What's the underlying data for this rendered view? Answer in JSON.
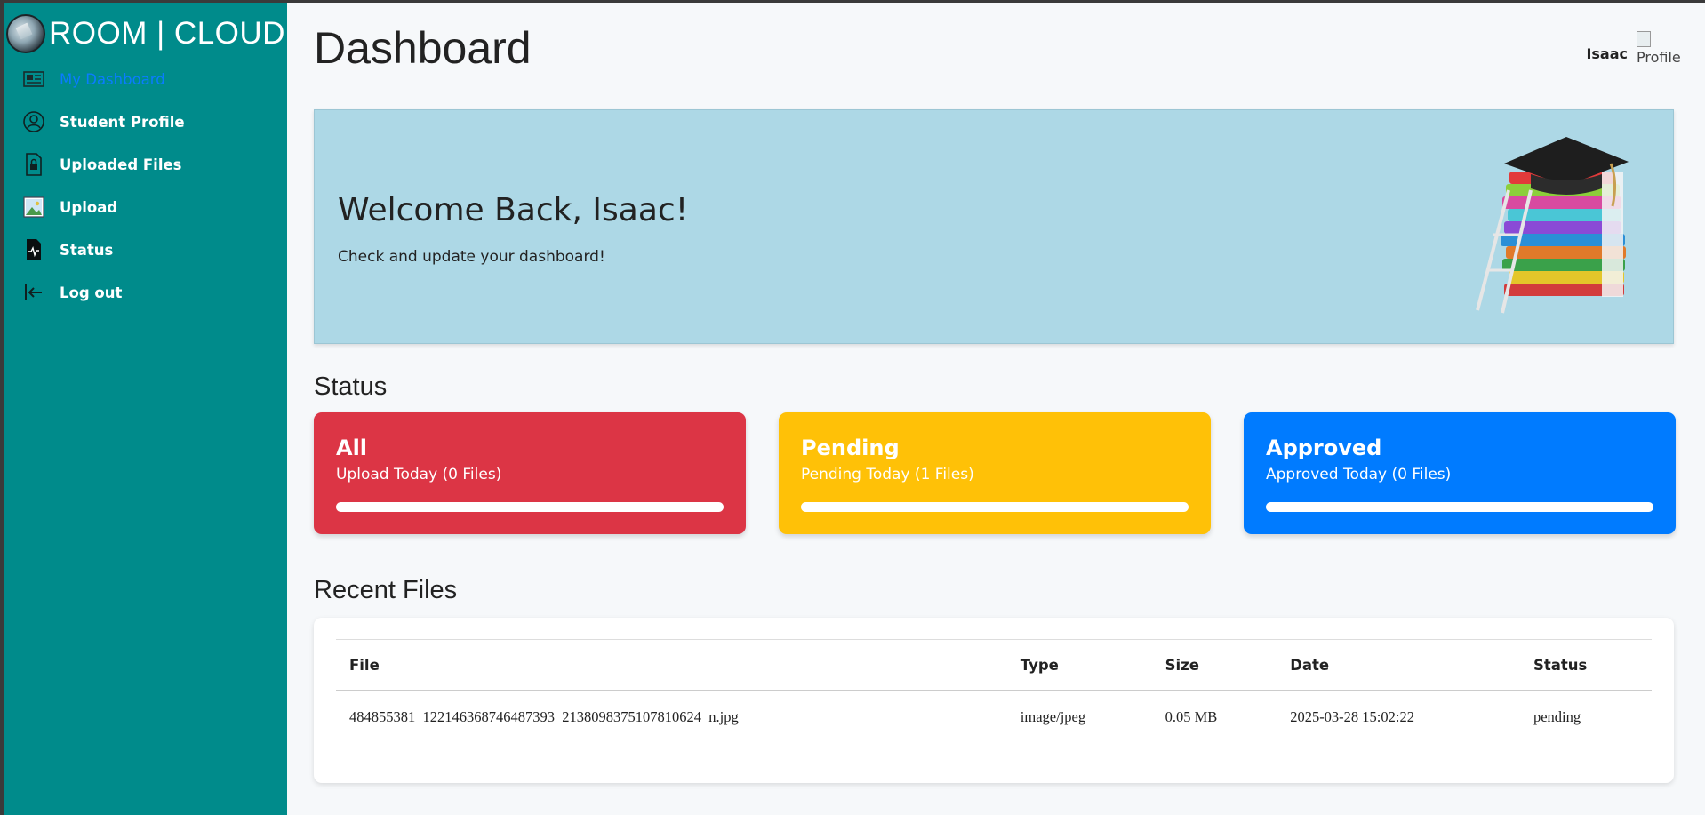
{
  "brand": {
    "name": "ROOM | CLOUD"
  },
  "sidebar": {
    "items": [
      {
        "label": "My Dashboard",
        "icon": "dashboard-icon",
        "active": true
      },
      {
        "label": "Student Profile",
        "icon": "user-circle-icon"
      },
      {
        "label": "Uploaded Files",
        "icon": "file-lock-icon"
      },
      {
        "label": "Upload",
        "icon": "image-upload-icon"
      },
      {
        "label": "Status",
        "icon": "file-chart-icon"
      },
      {
        "label": "Log out",
        "icon": "logout-icon"
      }
    ]
  },
  "header": {
    "title": "Dashboard",
    "user_name": "Isaac",
    "avatar_alt": "Profile"
  },
  "welcome": {
    "title": "Welcome Back, Isaac!",
    "subtitle": "Check and update your dashboard!"
  },
  "status": {
    "section_title": "Status",
    "cards": [
      {
        "title": "All",
        "subtitle": "Upload Today (0 Files)",
        "color": "#dc3545",
        "progress": 1.0
      },
      {
        "title": "Pending",
        "subtitle": "Pending Today (1 Files)",
        "color": "#ffc107",
        "progress": 1.0
      },
      {
        "title": "Approved",
        "subtitle": "Approved Today (0 Files)",
        "color": "#007bff",
        "progress": 1.0
      }
    ]
  },
  "recent_files": {
    "section_title": "Recent Files",
    "columns": [
      "File",
      "Type",
      "Size",
      "Date",
      "Status"
    ],
    "rows": [
      [
        "484855381_122146368746487393_2138098375107810624_n.jpg",
        "image/jpeg",
        "0.05 MB",
        "2025-03-28 15:02:22",
        "pending"
      ]
    ]
  },
  "colors": {
    "sidebar": "#008b8b",
    "active_nav": "#0a7cff",
    "welcome_bg": "#add8e6"
  }
}
